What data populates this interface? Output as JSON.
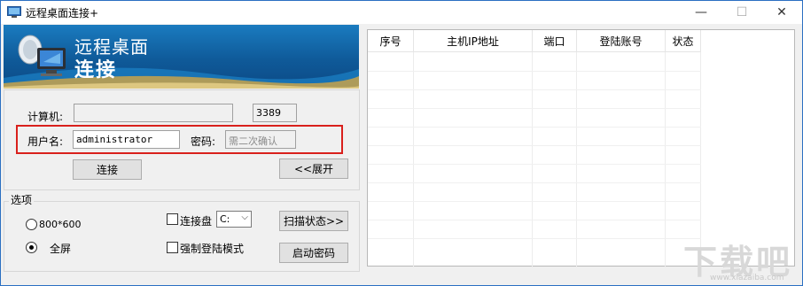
{
  "window": {
    "title": "远程桌面连接+",
    "min_glyph": "—",
    "max_glyph": "☐",
    "close_glyph": "✕"
  },
  "banner": {
    "title_line1": "远程桌面",
    "title_line2": "连接"
  },
  "form": {
    "computer_label": "计算机:",
    "computer_value": "",
    "port_value": "3389",
    "username_label": "用户名:",
    "username_value": "administrator",
    "password_label": "密码:",
    "password_placeholder": "需二次确认",
    "connect_button": "连接",
    "expand_button": "<<展开"
  },
  "options": {
    "group_title": "选项",
    "radio_800": "800*600",
    "radio_fullscreen": "全屏",
    "selected_radio": "全屏",
    "connect_drive_label": "连接盘",
    "connect_drive_checked": false,
    "drive_value": "C:",
    "force_login_label": "强制登陆模式",
    "force_login_checked": false,
    "scan_button": "扫描状态>>",
    "start_password_button": "启动密码"
  },
  "table": {
    "columns": [
      "序号",
      "主机IP地址",
      "端口",
      "登陆账号",
      "状态"
    ],
    "rows": []
  },
  "watermark": {
    "text": "下载吧",
    "url": "www.xiazaiba.com"
  },
  "colors": {
    "accent": "#2b6fc2",
    "highlight": "#d9201c",
    "banner": "#0f5a99"
  }
}
